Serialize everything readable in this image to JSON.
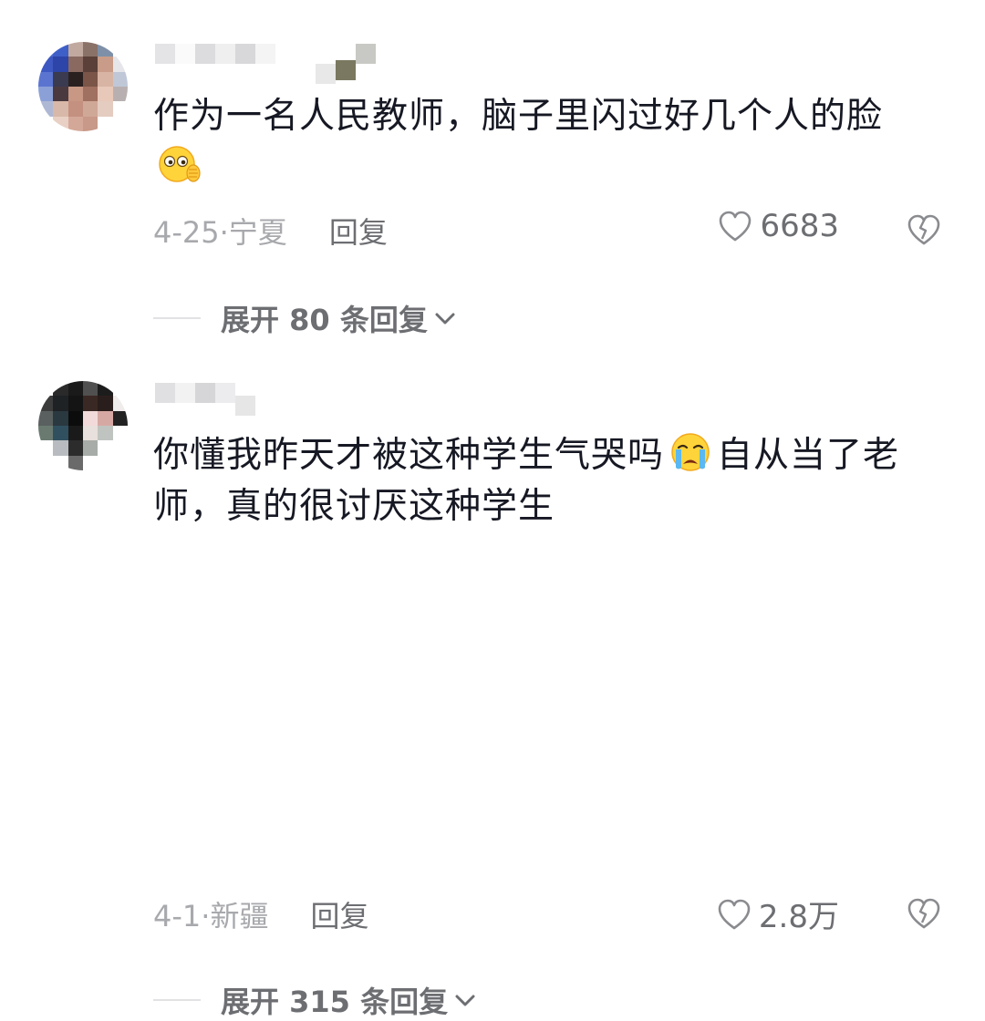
{
  "comments": [
    {
      "text_before": "作为一名人民教师，脑子里闪过好几个人的脸",
      "emoji_1": "thinking-face-emoji",
      "text_after": "",
      "date_location": "4-25·宁夏",
      "reply_label": "回复",
      "like_count": "6683",
      "expand_label": "展开 80 条回复"
    },
    {
      "text_before": "你懂我昨天才被这种学生气哭吗",
      "emoji_1": "crying-face-emoji",
      "text_after": "自从当了老师，真的很讨厌这种学生",
      "date_location": "4-1·新疆",
      "reply_label": "回复",
      "like_count": "2.8万",
      "expand_label": "展开 315 条回复"
    }
  ],
  "colors": {
    "text": "#161823",
    "meta": "#a8a9ad",
    "action": "#6d6e72"
  }
}
